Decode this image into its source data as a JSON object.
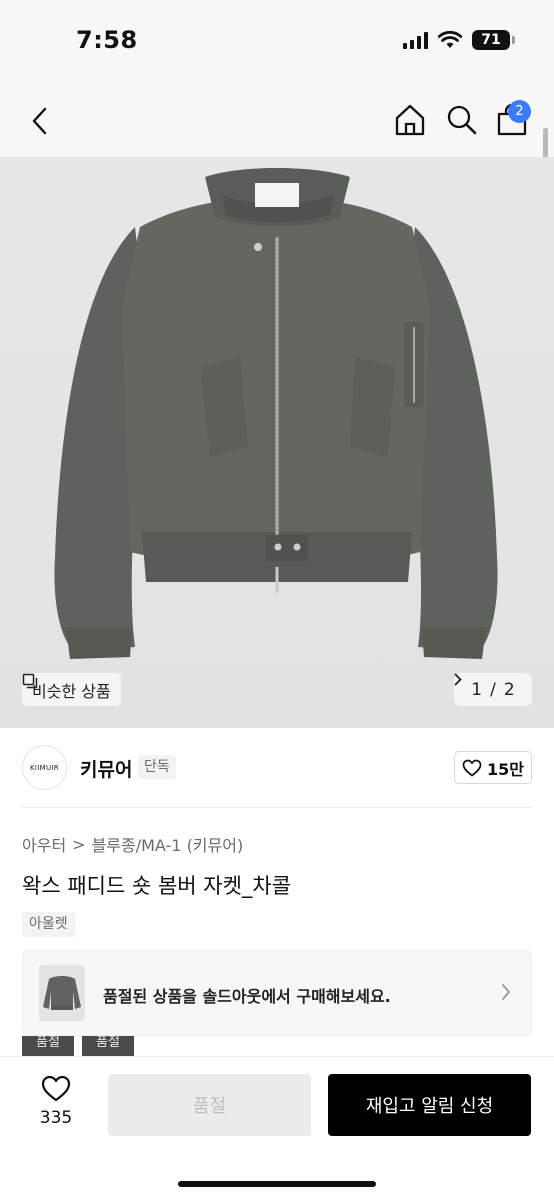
{
  "status": {
    "time": "7:58",
    "battery": "71"
  },
  "header": {
    "back_icon": "chevron-left-icon",
    "home_icon": "home-icon",
    "search_icon": "search-icon",
    "cart_icon": "shopping-bag-icon",
    "cart_count": "2"
  },
  "gallery": {
    "similar_label": "비슷한 상품",
    "current": "1",
    "separator": "/",
    "total": "2"
  },
  "brand": {
    "logo_text": "KIIMUIR",
    "name": "키뮤어",
    "badge": "단독",
    "like_count": "15만"
  },
  "breadcrumb": {
    "level1": "아우터",
    "separator": ">",
    "level2": "블루종/MA-1 (키뮤어)"
  },
  "product": {
    "title": "왁스 패디드 숏 봄버 자켓_차콜",
    "tag": "아울렛"
  },
  "banner": {
    "text": "품절된 상품을 솔드아웃에서 구매해보세요."
  },
  "options": [
    {
      "label": "품절"
    },
    {
      "label": "품절"
    }
  ],
  "bottom_bar": {
    "wish_count": "335",
    "soldout_label": "품절",
    "restock_label": "재입고 알림 신청"
  },
  "colors": {
    "accent_blue": "#3a7bf6",
    "jacket": "#5f645e",
    "primary_button": "#000000"
  }
}
